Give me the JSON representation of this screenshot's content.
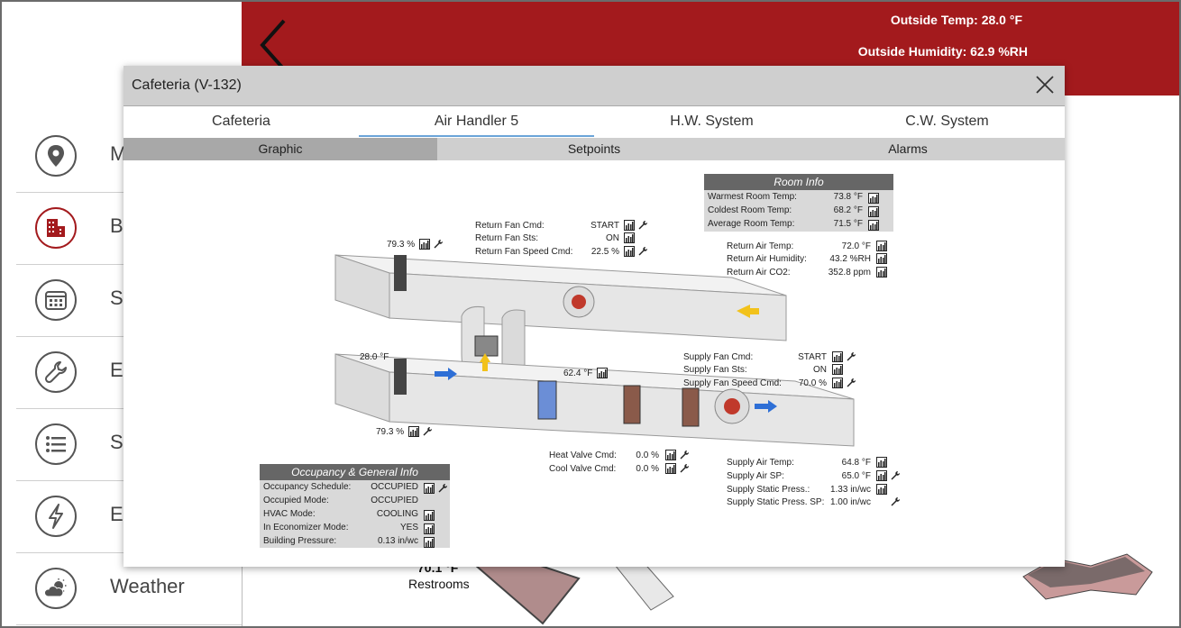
{
  "header": {
    "outside_temp": "Outside Temp: 28.0 °F",
    "outside_humidity": "Outside Humidity: 62.9 %RH"
  },
  "sidebar": {
    "items": [
      {
        "label": "M",
        "icon": "location-pin-icon"
      },
      {
        "label": "B",
        "icon": "building-icon"
      },
      {
        "label": "S",
        "icon": "calendar-icon"
      },
      {
        "label": "E",
        "icon": "wrench-icon"
      },
      {
        "label": "S",
        "icon": "list-icon"
      },
      {
        "label": "E",
        "icon": "lightning-icon"
      },
      {
        "label": "Weather",
        "icon": "weather-icon"
      }
    ]
  },
  "background": {
    "temp_label": "70.1 °F",
    "room_label": "Restrooms"
  },
  "modal": {
    "title": "Cafeteria (V-132)",
    "tabs": [
      "Cafeteria",
      "Air Handler 5",
      "H.W. System",
      "C.W. System"
    ],
    "active_tab": "Air Handler 5",
    "subtabs": [
      "Graphic",
      "Setpoints",
      "Alarms"
    ],
    "active_subtab": "Graphic"
  },
  "graphic": {
    "return_fan": {
      "cmd_label": "Return Fan Cmd:",
      "cmd_value": "START",
      "sts_label": "Return Fan Sts:",
      "sts_value": "ON",
      "speed_label": "Return Fan Speed Cmd:",
      "speed_value": "22.5 %"
    },
    "room_info": {
      "title": "Room Info",
      "warmest_label": "Warmest Room Temp:",
      "warmest_value": "73.8 °F",
      "coldest_label": "Coldest Room Temp:",
      "coldest_value": "68.2 °F",
      "average_label": "Average Room Temp:",
      "average_value": "71.5 °F"
    },
    "return_air": {
      "temp_label": "Return Air Temp:",
      "temp_value": "72.0 °F",
      "hum_label": "Return Air Humidity:",
      "hum_value": "43.2 %RH",
      "co2_label": "Return Air CO2:",
      "co2_value": "352.8 ppm"
    },
    "exhaust_damper": "79.3 %",
    "outside_air_temp": "28.0 °F",
    "outside_damper": "79.3 %",
    "mixed_air_temp": "62.4 °F",
    "supply_fan": {
      "cmd_label": "Supply Fan Cmd:",
      "cmd_value": "START",
      "sts_label": "Supply Fan Sts:",
      "sts_value": "ON",
      "speed_label": "Supply Fan Speed Cmd:",
      "speed_value": "70.0 %"
    },
    "valves": {
      "heat_label": "Heat Valve Cmd:",
      "heat_value": "0.0 %",
      "cool_label": "Cool Valve Cmd:",
      "cool_value": "0.0 %"
    },
    "supply_air": {
      "temp_label": "Supply Air Temp:",
      "temp_value": "64.8 °F",
      "sp_label": "Supply Air SP:",
      "sp_value": "65.0 °F",
      "static_label": "Supply Static Press.:",
      "static_value": "1.33 in/wc",
      "static_sp_label": "Supply Static Press. SP:",
      "static_sp_value": "1.00 in/wc"
    },
    "occupancy": {
      "title": "Occupancy & General Info",
      "schedule_label": "Occupancy Schedule:",
      "schedule_value": "OCCUPIED",
      "mode_label": "Occupied Mode:",
      "mode_value": "OCCUPIED",
      "hvac_label": "HVAC Mode:",
      "hvac_value": "COOLING",
      "econ_label": "In Economizer Mode:",
      "econ_value": "YES",
      "bldg_label": "Building Pressure:",
      "bldg_value": "0.13 in/wc"
    }
  },
  "colors": {
    "brand_red": "#a31a1d",
    "airflow_blue": "#2e6fd6",
    "airflow_yellow": "#f2c21b"
  }
}
